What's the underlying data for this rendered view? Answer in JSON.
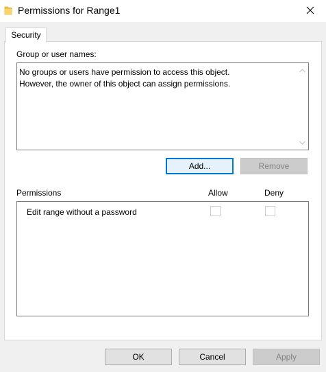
{
  "window": {
    "title": "Permissions for Range1",
    "close_icon": "close-icon",
    "title_icon": "folder-icon"
  },
  "tabs": [
    {
      "label": "Security",
      "selected": true
    }
  ],
  "group_section": {
    "label": "Group or user names:",
    "message_line1": "No groups or users have permission to access this object.",
    "message_line2": "However, the owner of this object can assign permissions."
  },
  "group_buttons": {
    "add": "Add...",
    "remove": "Remove"
  },
  "permissions": {
    "header": "Permissions",
    "allow_header": "Allow",
    "deny_header": "Deny",
    "rows": [
      {
        "label": "Edit range without a password",
        "allow": false,
        "deny": false
      }
    ]
  },
  "dialog_buttons": {
    "ok": "OK",
    "cancel": "Cancel",
    "apply": "Apply"
  },
  "colors": {
    "accent": "#0078d7",
    "disabled_text": "#838383"
  }
}
